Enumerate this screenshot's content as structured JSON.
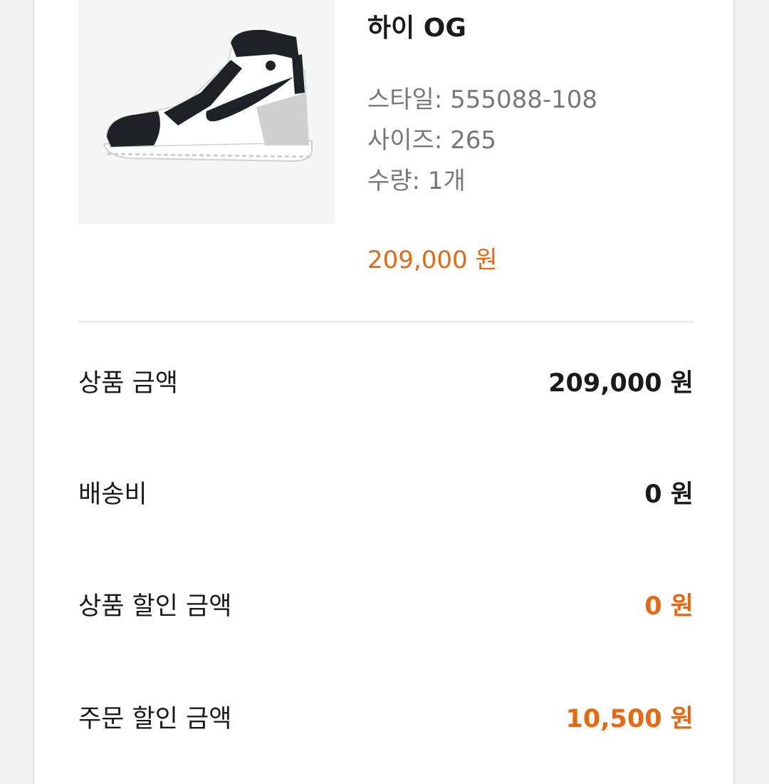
{
  "product": {
    "title": "하이 OG",
    "style_label": "스타일:",
    "style_value": "555088-108",
    "size_label": "사이즈:",
    "size_value": "265",
    "qty_label": "수량:",
    "qty_value": "1개",
    "price": "209,000 원",
    "image_icon": "sneaker-product-image"
  },
  "summary": {
    "rows": [
      {
        "label": "상품 금액",
        "value": "209,000 원"
      },
      {
        "label": "배송비",
        "value": "0 원"
      },
      {
        "label": "상품 할인 금액",
        "value": "0 원"
      },
      {
        "label": "주문 할인 금액",
        "value": "10,500 원"
      }
    ]
  },
  "colors": {
    "accent": "#e8670f",
    "text": "#1a1a1a",
    "muted": "#777777"
  }
}
